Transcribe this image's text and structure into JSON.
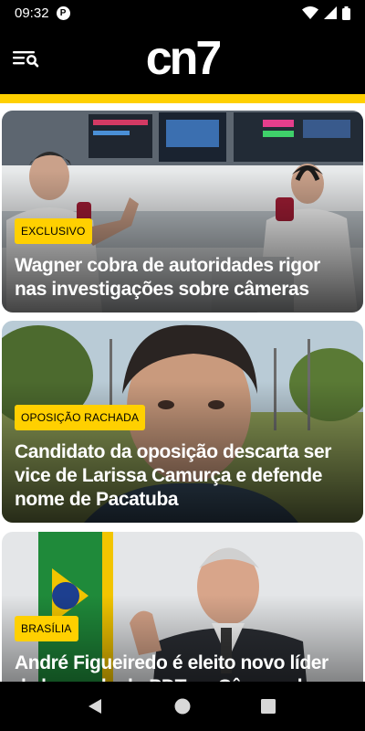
{
  "status_bar": {
    "time": "09:32",
    "app_icon": "P",
    "icons": [
      "wifi-icon",
      "signal-icon",
      "battery-icon"
    ]
  },
  "header": {
    "logo": "cn7",
    "menu_icon": "menu-search-icon",
    "accent_color": "#ffd000"
  },
  "articles": [
    {
      "tag": "EXCLUSIVO",
      "title": "Wagner cobra de autoridades rigor nas investigações sobre câmeras"
    },
    {
      "tag": "OPOSIÇÃO RACHADA",
      "title": "Candidato da oposição descarta ser vice de Larissa Camurça e defende nome de Pacatuba"
    },
    {
      "tag": "BRASÍLIA",
      "title": "André Figueiredo é eleito novo líder da bancada do PDT na Câmara dos Deputados"
    }
  ],
  "nav": {
    "icons": [
      "back-icon",
      "home-icon",
      "recents-icon"
    ]
  }
}
